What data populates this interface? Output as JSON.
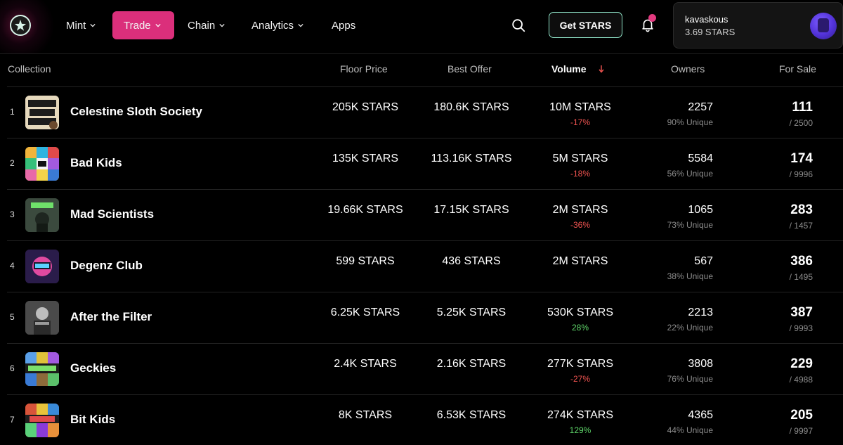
{
  "nav": {
    "items": [
      {
        "label": "Mint",
        "has_menu": true
      },
      {
        "label": "Trade",
        "has_menu": true,
        "active": true
      },
      {
        "label": "Chain",
        "has_menu": true
      },
      {
        "label": "Analytics",
        "has_menu": true
      },
      {
        "label": "Apps",
        "has_menu": false
      }
    ],
    "get_stars_label": "Get STARS",
    "notification_badge": true
  },
  "wallet": {
    "username": "kavaskous",
    "balance": "3.69 STARS"
  },
  "table": {
    "headers": {
      "collection": "Collection",
      "floor_price": "Floor Price",
      "best_offer": "Best Offer",
      "volume": "Volume",
      "owners": "Owners",
      "for_sale": "For Sale"
    },
    "sort": {
      "column": "volume",
      "direction": "desc"
    },
    "rows": [
      {
        "rank": "1",
        "name": "Celestine Sloth Society",
        "floor": "205K STARS",
        "offer": "180.6K STARS",
        "volume": "10M STARS",
        "change": "-17%",
        "change_dir": "neg",
        "owners": "2257",
        "unique": "90% Unique",
        "for_sale": "111",
        "supply": "/ 2500"
      },
      {
        "rank": "2",
        "name": "Bad Kids",
        "floor": "135K STARS",
        "offer": "113.16K STARS",
        "volume": "5M STARS",
        "change": "-18%",
        "change_dir": "neg",
        "owners": "5584",
        "unique": "56% Unique",
        "for_sale": "174",
        "supply": "/ 9996"
      },
      {
        "rank": "3",
        "name": "Mad Scientists",
        "floor": "19.66K STARS",
        "offer": "17.15K STARS",
        "volume": "2M STARS",
        "change": "-36%",
        "change_dir": "neg",
        "owners": "1065",
        "unique": "73% Unique",
        "for_sale": "283",
        "supply": "/ 1457"
      },
      {
        "rank": "4",
        "name": "Degenz Club",
        "floor": "599 STARS",
        "offer": "436 STARS",
        "volume": "2M STARS",
        "change": "",
        "change_dir": "none",
        "owners": "567",
        "unique": "38% Unique",
        "for_sale": "386",
        "supply": "/ 1495"
      },
      {
        "rank": "5",
        "name": "After the Filter",
        "floor": "6.25K STARS",
        "offer": "5.25K STARS",
        "volume": "530K STARS",
        "change": "28%",
        "change_dir": "pos",
        "owners": "2213",
        "unique": "22% Unique",
        "for_sale": "387",
        "supply": "/ 9993"
      },
      {
        "rank": "6",
        "name": "Geckies",
        "floor": "2.4K STARS",
        "offer": "2.16K STARS",
        "volume": "277K STARS",
        "change": "-27%",
        "change_dir": "neg",
        "owners": "3808",
        "unique": "76% Unique",
        "for_sale": "229",
        "supply": "/ 4988"
      },
      {
        "rank": "7",
        "name": "Bit Kids",
        "floor": "8K STARS",
        "offer": "6.53K STARS",
        "volume": "274K STARS",
        "change": "129%",
        "change_dir": "pos",
        "owners": "4365",
        "unique": "44% Unique",
        "for_sale": "205",
        "supply": "/ 9997"
      }
    ]
  },
  "colors": {
    "accent": "#db2f7b",
    "get_stars_border": "#8fe3c7",
    "negative": "#ef5350",
    "positive": "#5fd66a"
  },
  "icons": {
    "logo": "stargaze-star-logo",
    "search": "search-icon",
    "bell": "bell-icon",
    "sort": "arrow-down-icon"
  }
}
